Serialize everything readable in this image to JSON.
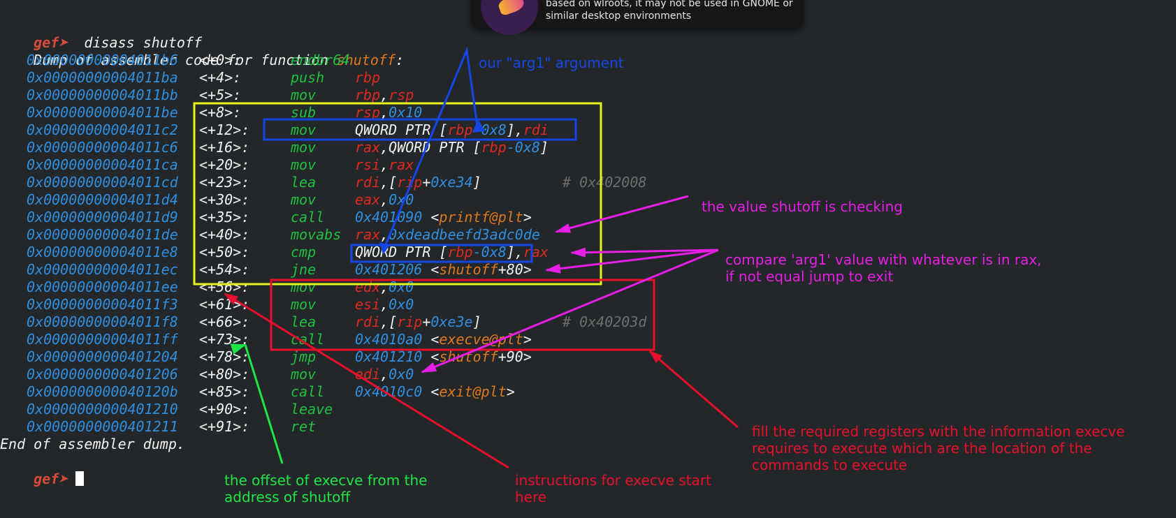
{
  "notification": {
    "text": "based on wlroots, it may not be used in GNOME or\nsimilar desktop environments"
  },
  "terminal": {
    "prompt": "gef➤ ",
    "command": " disass shutoff",
    "dump_header_prefix": "Dump of assembler code for function ",
    "dump_header_fn": "shutoff",
    "dump_header_suffix": ":",
    "lines": [
      {
        "addr": "0x00000000004011b6",
        "off": "<+0>:",
        "mn": "endbr64",
        "ops": []
      },
      {
        "addr": "0x00000000004011ba",
        "off": "<+4>:",
        "mn": "push",
        "ops": [
          [
            "reg",
            "rbp"
          ]
        ]
      },
      {
        "addr": "0x00000000004011bb",
        "off": "<+5>:",
        "mn": "mov",
        "ops": [
          [
            "reg",
            "rbp"
          ],
          [
            "txt",
            ","
          ],
          [
            "reg",
            "rsp"
          ]
        ]
      },
      {
        "addr": "0x00000000004011be",
        "off": "<+8>:",
        "mn": "sub",
        "ops": [
          [
            "reg",
            "rsp"
          ],
          [
            "txt",
            ","
          ],
          [
            "num",
            "0x10"
          ]
        ]
      },
      {
        "addr": "0x00000000004011c2",
        "off": "<+12>:",
        "mn": "mov",
        "ops": [
          [
            "txt",
            "QWORD PTR ["
          ],
          [
            "reg",
            "rbp"
          ],
          [
            "num",
            "-0x8"
          ],
          [
            "txt",
            "],"
          ],
          [
            "reg",
            "rdi"
          ]
        ]
      },
      {
        "addr": "0x00000000004011c6",
        "off": "<+16>:",
        "mn": "mov",
        "ops": [
          [
            "reg",
            "rax"
          ],
          [
            "txt",
            ",QWORD PTR ["
          ],
          [
            "reg",
            "rbp"
          ],
          [
            "num",
            "-0x8"
          ],
          [
            "txt",
            "]"
          ]
        ]
      },
      {
        "addr": "0x00000000004011ca",
        "off": "<+20>:",
        "mn": "mov",
        "ops": [
          [
            "reg",
            "rsi"
          ],
          [
            "txt",
            ","
          ],
          [
            "reg",
            "rax"
          ]
        ]
      },
      {
        "addr": "0x00000000004011cd",
        "off": "<+23>:",
        "mn": "lea",
        "ops": [
          [
            "reg",
            "rdi"
          ],
          [
            "txt",
            ",["
          ],
          [
            "reg",
            "rip"
          ],
          [
            "txt",
            "+"
          ],
          [
            "num",
            "0xe34"
          ],
          [
            "txt",
            "]"
          ]
        ],
        "cmt": "# 0x402008"
      },
      {
        "addr": "0x00000000004011d4",
        "off": "<+30>:",
        "mn": "mov",
        "ops": [
          [
            "reg",
            "eax"
          ],
          [
            "txt",
            ","
          ],
          [
            "num",
            "0x0"
          ]
        ]
      },
      {
        "addr": "0x00000000004011d9",
        "off": "<+35>:",
        "mn": "call",
        "ops": [
          [
            "num",
            "0x401090"
          ],
          [
            "txt",
            " <"
          ],
          [
            "fn",
            "printf@plt"
          ],
          [
            "txt",
            ">"
          ]
        ]
      },
      {
        "addr": "0x00000000004011de",
        "off": "<+40>:",
        "mn": "movabs",
        "ops": [
          [
            "reg",
            "rax"
          ],
          [
            "txt",
            ","
          ],
          [
            "num",
            "0xdeadbeefd3adc0de"
          ]
        ]
      },
      {
        "addr": "0x00000000004011e8",
        "off": "<+50>:",
        "mn": "cmp",
        "ops": [
          [
            "txt",
            "QWORD PTR ["
          ],
          [
            "reg",
            "rbp"
          ],
          [
            "num",
            "-0x8"
          ],
          [
            "txt",
            "],"
          ],
          [
            "reg",
            "rax"
          ]
        ]
      },
      {
        "addr": "0x00000000004011ec",
        "off": "<+54>:",
        "mn": "jne",
        "ops": [
          [
            "num",
            "0x401206"
          ],
          [
            "txt",
            " <"
          ],
          [
            "fn",
            "shutoff"
          ],
          [
            "txt",
            "+80>"
          ]
        ]
      },
      {
        "addr": "0x00000000004011ee",
        "off": "<+56>:",
        "mn": "mov",
        "ops": [
          [
            "reg",
            "edx"
          ],
          [
            "txt",
            ","
          ],
          [
            "num",
            "0x0"
          ]
        ]
      },
      {
        "addr": "0x00000000004011f3",
        "off": "<+61>:",
        "mn": "mov",
        "ops": [
          [
            "reg",
            "esi"
          ],
          [
            "txt",
            ","
          ],
          [
            "num",
            "0x0"
          ]
        ]
      },
      {
        "addr": "0x00000000004011f8",
        "off": "<+66>:",
        "mn": "lea",
        "ops": [
          [
            "reg",
            "rdi"
          ],
          [
            "txt",
            ",["
          ],
          [
            "reg",
            "rip"
          ],
          [
            "txt",
            "+"
          ],
          [
            "num",
            "0xe3e"
          ],
          [
            "txt",
            "]"
          ]
        ],
        "cmt": "# 0x40203d"
      },
      {
        "addr": "0x00000000004011ff",
        "off": "<+73>:",
        "mn": "call",
        "ops": [
          [
            "num",
            "0x4010a0"
          ],
          [
            "txt",
            " <"
          ],
          [
            "fn",
            "execve@plt"
          ],
          [
            "txt",
            ">"
          ]
        ]
      },
      {
        "addr": "0x0000000000401204",
        "off": "<+78>:",
        "mn": "jmp",
        "ops": [
          [
            "num",
            "0x401210"
          ],
          [
            "txt",
            " <"
          ],
          [
            "fn",
            "shutoff"
          ],
          [
            "txt",
            "+90>"
          ]
        ]
      },
      {
        "addr": "0x0000000000401206",
        "off": "<+80>:",
        "mn": "mov",
        "ops": [
          [
            "reg",
            "edi"
          ],
          [
            "txt",
            ","
          ],
          [
            "num",
            "0x0"
          ]
        ]
      },
      {
        "addr": "0x000000000040120b",
        "off": "<+85>:",
        "mn": "call",
        "ops": [
          [
            "num",
            "0x4010c0"
          ],
          [
            "txt",
            " <"
          ],
          [
            "fn",
            "exit@plt"
          ],
          [
            "txt",
            ">"
          ]
        ]
      },
      {
        "addr": "0x0000000000401210",
        "off": "<+90>:",
        "mn": "leave",
        "ops": []
      },
      {
        "addr": "0x0000000000401211",
        "off": "<+91>:",
        "mn": "ret",
        "ops": []
      }
    ],
    "dump_footer": "End of assembler dump."
  },
  "annotations": {
    "arg1": "our \"arg1\" argument",
    "value_checked": "the value shutoff is checking",
    "compare": "compare 'arg1' value with whatever is in rax,\nif not equal jump to exit",
    "fill_registers": "fill the required registers with the information execve\nrequires to execute which are the location of the\ncommands to execute",
    "execve_start": "instructions for execve start\nhere",
    "offset": "the offset of execve from the\naddress of shutoff"
  },
  "colors": {
    "background": "#232729",
    "address": "#2f8fe0",
    "mnemonic": "#20c040",
    "register": "#e02a20",
    "function": "#e0781c",
    "yellow_box": "#e6f01e",
    "blue_annotation": "#1446e6",
    "magenta_annotation": "#e61ee6",
    "red_annotation": "#e6102c",
    "green_annotation": "#1ee646"
  }
}
